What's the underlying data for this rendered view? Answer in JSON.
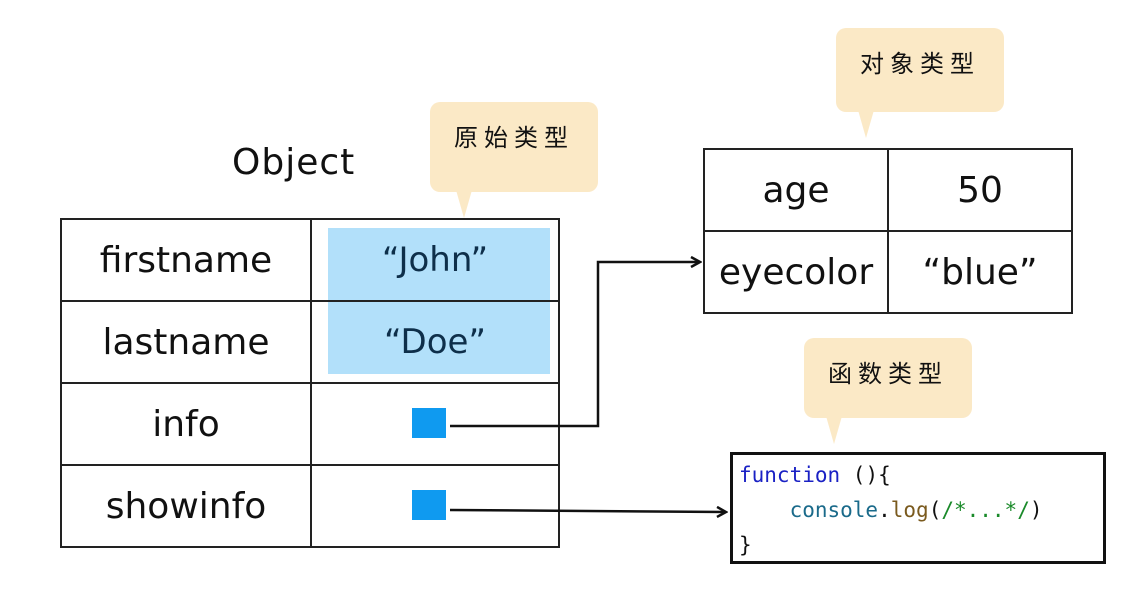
{
  "object_title": "Object",
  "object_table": {
    "rows": [
      {
        "key": "firstname",
        "value": "“John”",
        "value_type": "primitive"
      },
      {
        "key": "lastname",
        "value": "“Doe”",
        "value_type": "primitive"
      },
      {
        "key": "info",
        "value": "",
        "value_type": "pointer"
      },
      {
        "key": "showinfo",
        "value": "",
        "value_type": "pointer"
      }
    ]
  },
  "nested_object_table": {
    "rows": [
      {
        "key": "age",
        "value": "50"
      },
      {
        "key": "eyecolor",
        "value": "“blue”"
      }
    ]
  },
  "function_code": {
    "line1_keyword": "function",
    "line1_rest": " (){",
    "line2_indent": "    ",
    "line2_ident": "console",
    "line2_dot": ".",
    "line2_fn": "log",
    "line2_open": "(",
    "line2_comment": "/*...*/",
    "line2_close": ")",
    "line3": "}"
  },
  "callouts": {
    "primitive": "原始类型",
    "object": "对象类型",
    "function": "函数类型"
  },
  "colors": {
    "primitive_highlight": "#b2e0fa",
    "pointer": "#0f9af0",
    "callout": "#fbe9c6",
    "keyword": "#1a21c4",
    "comment": "#1a8a2a"
  }
}
